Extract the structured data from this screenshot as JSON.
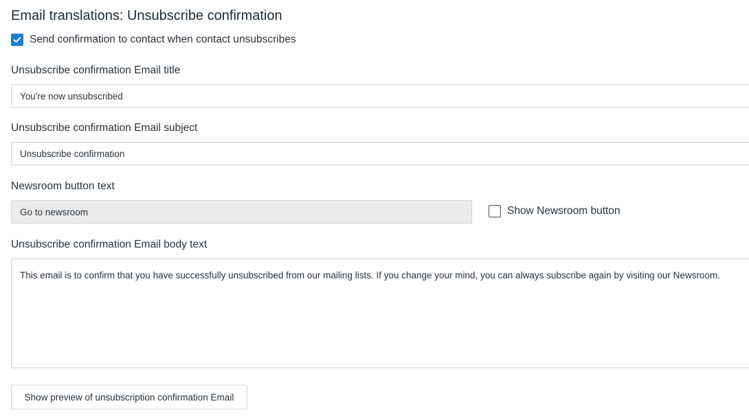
{
  "page": {
    "title": "Email translations: Unsubscribe confirmation"
  },
  "send_confirmation": {
    "label": "Send confirmation to contact when contact unsubscribes",
    "checked": true
  },
  "email_title": {
    "label": "Unsubscribe confirmation Email title",
    "value": "You're now unsubscribed"
  },
  "email_subject": {
    "label": "Unsubscribe confirmation Email subject",
    "value": "Unsubscribe confirmation"
  },
  "newsroom_button": {
    "label": "Newsroom button text",
    "value": "Go to newsroom",
    "disabled": true,
    "show_label": "Show Newsroom button",
    "show_checked": false
  },
  "email_body": {
    "label": "Unsubscribe confirmation Email body text",
    "value": "This email is to confirm that you have successfully unsubscribed from our mailing lists. If you change your mind, you can always subscribe again by visiting our Newsroom."
  },
  "preview_button": {
    "label": "Show preview of unsubscription confirmation Email"
  },
  "colors": {
    "checkbox_checked": "#1a7fd1",
    "disabled_field": "#ececec"
  }
}
